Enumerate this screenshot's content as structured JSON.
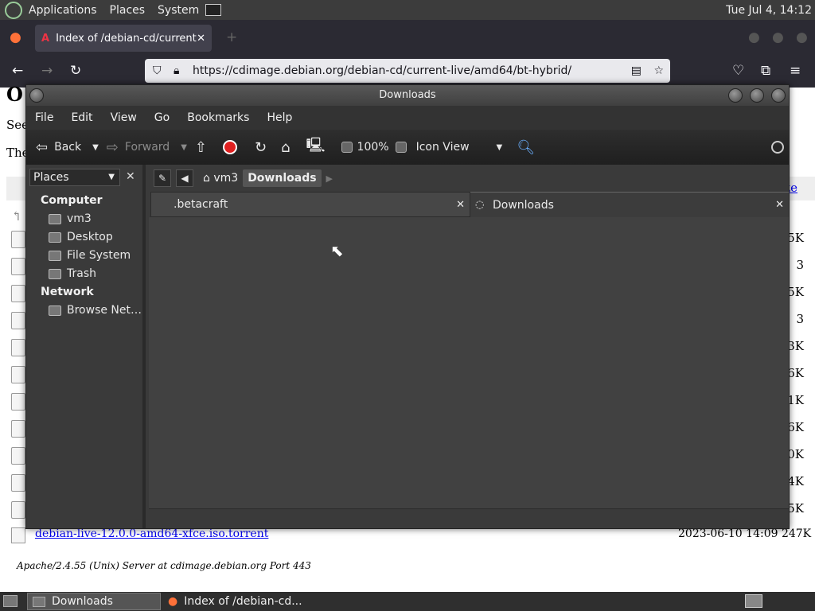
{
  "top_panel": {
    "menus": [
      "Applications",
      "Places",
      "System"
    ],
    "clock": "Tue Jul  4, 14:12"
  },
  "firefox": {
    "tab_title": "Index of /debian-cd/current-",
    "url": "https://cdimage.debian.org/debian-cd/current-live/amd64/bt-hybrid/"
  },
  "webpage": {
    "frag_heading": "O",
    "frag_see": "See",
    "frag_the": "The",
    "frag_ze": "ze",
    "sizes": [
      "5K",
      "3",
      "5K",
      "3",
      "3K",
      "6K",
      "1K",
      "6K",
      "0K",
      "4K",
      "5K"
    ],
    "last_file": "debian-live-12.0.0-amd64-xfce.iso.torrent",
    "last_date": "2023-06-10 14:09   247K",
    "server_line": "Apache/2.4.55 (Unix) Server at cdimage.debian.org Port 443"
  },
  "file_manager": {
    "title": "Downloads",
    "menu": [
      "File",
      "Edit",
      "View",
      "Go",
      "Bookmarks",
      "Help"
    ],
    "toolbar": {
      "back": "Back",
      "forward": "Forward",
      "zoom": "100%",
      "view_mode": "Icon View"
    },
    "sidebar": {
      "header": "Places",
      "groups": [
        {
          "label": "Computer",
          "items": [
            "vm3",
            "Desktop",
            "File System",
            "Trash"
          ]
        },
        {
          "label": "Network",
          "items": [
            "Browse Net…"
          ]
        }
      ]
    },
    "path": [
      "vm3",
      "Downloads"
    ],
    "tabs": [
      ".betacraft",
      "Downloads"
    ]
  },
  "taskbar": {
    "items": [
      "Downloads",
      "Index of /debian-cd..."
    ]
  }
}
